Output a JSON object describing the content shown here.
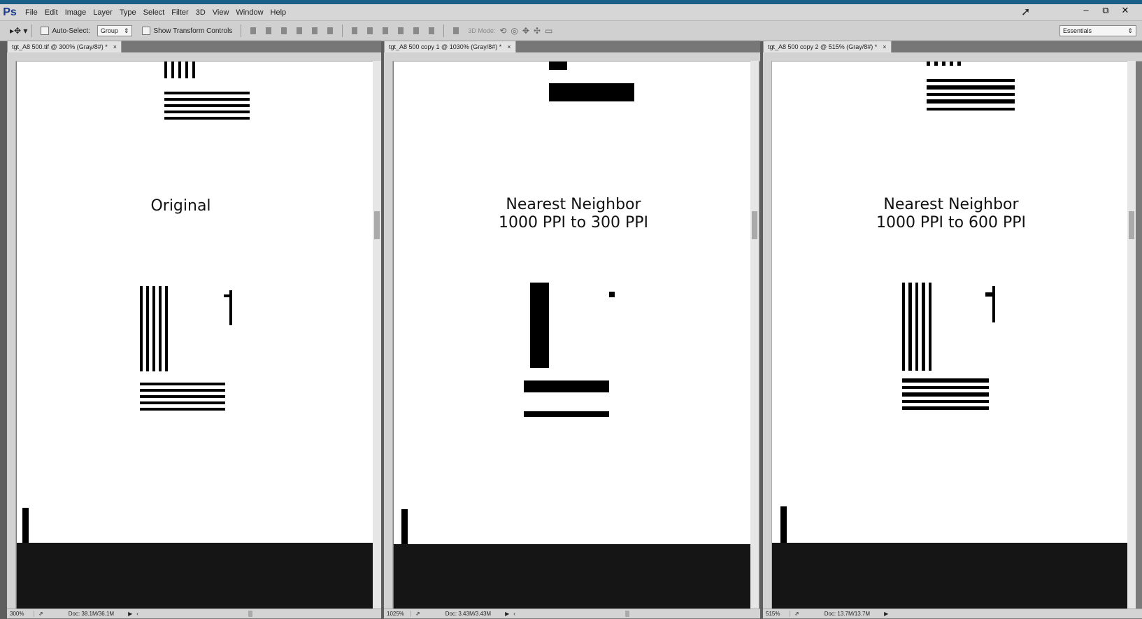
{
  "app": {
    "logo": "Ps"
  },
  "menu": [
    "File",
    "Edit",
    "Image",
    "Layer",
    "Type",
    "Select",
    "Filter",
    "3D",
    "View",
    "Window",
    "Help"
  ],
  "window_controls": [
    "–",
    "⧉",
    "✕"
  ],
  "options": {
    "auto_select_label": "Auto-Select:",
    "auto_select_value": "Group",
    "show_transform_label": "Show Transform Controls",
    "mode_3d_label": "3D Mode:",
    "workspace": "Essentials"
  },
  "panes": [
    {
      "tab_title": "tgt_A8 500.tif @ 300% (Gray/8#) *",
      "caption_lines": [
        "Original"
      ],
      "zoom": "300%",
      "doc_size": "Doc: 38.1M/36.1M"
    },
    {
      "tab_title": "tgt_A8 500 copy 1 @ 1030% (Gray/8#) *",
      "caption_lines": [
        "Nearest Neighbor",
        "1000 PPI to 300 PPI"
      ],
      "zoom": "1025%",
      "doc_size": "Doc: 3.43M/3.43M"
    },
    {
      "tab_title": "tgt_A8 500 copy 2 @ 515% (Gray/8#) *",
      "caption_lines": [
        "Nearest Neighbor",
        "1000 PPI to 600 PPI"
      ],
      "zoom": "515%",
      "doc_size": "Doc: 13.7M/13.7M"
    }
  ],
  "close_glyph": "×",
  "target_digit": "1"
}
